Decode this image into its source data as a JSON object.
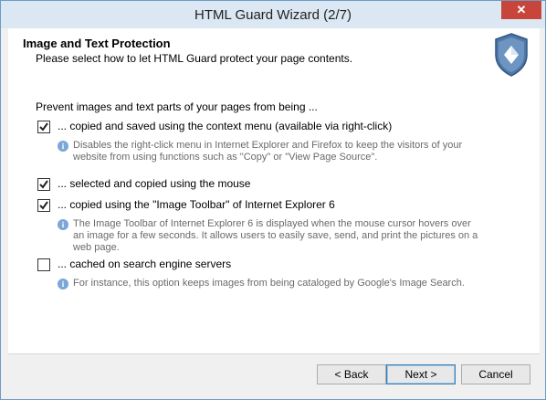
{
  "window": {
    "title": "HTML Guard Wizard (2/7)",
    "close_glyph": "✕"
  },
  "header": {
    "title": "Image and Text Protection",
    "subtitle": "Please select how to let HTML Guard protect your page contents."
  },
  "intro": "Prevent images and text parts of your pages from being ...",
  "options": [
    {
      "label": "... copied and saved using the context menu (available via right-click)",
      "checked": true,
      "info": "Disables the right-click menu in Internet Explorer and Firefox to keep the visitors of your website from using functions such as \"Copy\" or \"View Page Source\"."
    },
    {
      "label": "... selected and copied using the mouse",
      "checked": true,
      "info": ""
    },
    {
      "label": "... copied using the \"Image Toolbar\" of Internet Explorer 6",
      "checked": true,
      "info": "The Image Toolbar of Internet Explorer 6 is displayed when the mouse cursor hovers over an image for a few seconds. It allows users to easily save, send, and print the pictures on a web page."
    },
    {
      "label": "... cached on search engine servers",
      "checked": false,
      "info": "For instance, this option keeps images from being cataloged by Google's Image Search."
    }
  ],
  "buttons": {
    "back": "< Back",
    "next": "Next >",
    "cancel": "Cancel"
  },
  "info_glyph": "i",
  "icons": {
    "shield": "shield-icon",
    "info": "info-icon",
    "check": "check-icon"
  },
  "colors": {
    "accent": "#3c7fb1",
    "close": "#c7453a"
  }
}
